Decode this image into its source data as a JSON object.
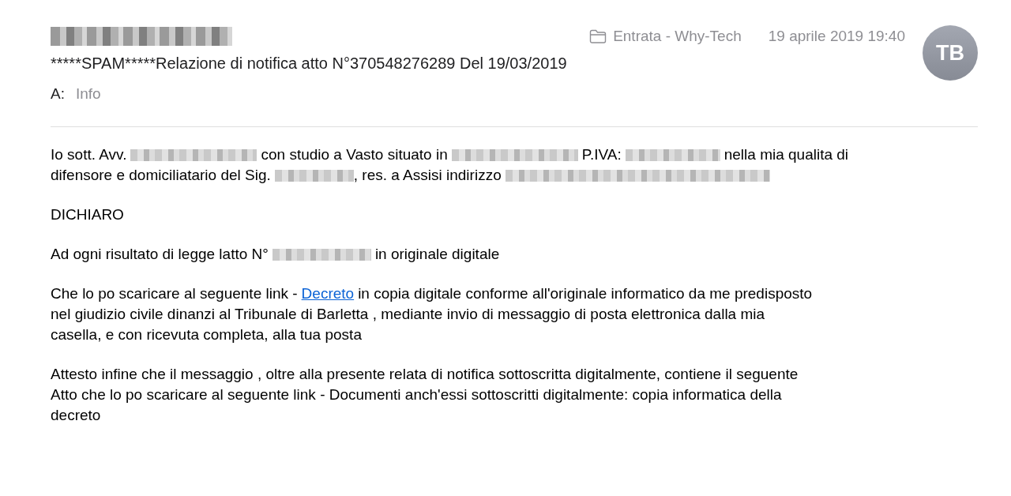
{
  "header": {
    "sender": {
      "kind": "redacted"
    },
    "folder": "Entrata - Why-Tech",
    "date": "19 aprile 2019 19:40",
    "avatar": "TB",
    "subject": "*****SPAM*****Relazione di notifica atto N°370548276289 Del 19/03/2019",
    "to_label": "A:",
    "to": "Info"
  },
  "body": [
    [
      [
        {
          "kind": "text",
          "text": "Io sott. Avv."
        },
        {
          "kind": "redacted"
        },
        {
          "kind": "text",
          "text": "con studio a Vasto situato in"
        },
        {
          "kind": "redacted"
        },
        {
          "kind": "text",
          "text": "P.IVA:"
        },
        {
          "kind": "redacted"
        },
        {
          "kind": "text",
          "text": "nella mia qualita di"
        }
      ],
      [
        {
          "kind": "text",
          "text": "difensore e domiciliatario del Sig."
        },
        {
          "kind": "redacted"
        },
        {
          "kind": "text",
          "text": ", res. a Assisi indirizzo"
        },
        {
          "kind": "redacted"
        }
      ]
    ],
    [
      [
        {
          "kind": "text",
          "text": "DICHIARO"
        }
      ]
    ],
    [
      [
        {
          "kind": "text",
          "text": "Ad ogni risultato di legge latto N°"
        },
        {
          "kind": "redacted"
        },
        {
          "kind": "text",
          "text": "in originale digitale"
        }
      ]
    ],
    [
      [
        {
          "kind": "text",
          "text": "Che lo po scaricare al seguente link -"
        },
        {
          "kind": "link",
          "text": "Decreto"
        },
        {
          "kind": "text",
          "text": "in copia digitale conforme all'originale informatico da me predisposto"
        }
      ],
      [
        {
          "kind": "text",
          "text": "nel giudizio civile dinanzi al Tribunale di Barletta , mediante invio di messaggio di posta elettronica dalla mia"
        }
      ],
      [
        {
          "kind": "text",
          "text": "casella, e con ricevuta completa, alla tua posta"
        }
      ]
    ],
    [
      [
        {
          "kind": "text",
          "text": "Attesto infine che il messaggio , oltre alla presente relata di notifica sottoscritta digitalmente, contiene il seguente"
        }
      ],
      [
        {
          "kind": "text",
          "text": "Atto che lo po scaricare al seguente link - Documenti anch'essi sottoscritti digitalmente: copia informatica della"
        }
      ],
      [
        {
          "kind": "text",
          "text": "decreto"
        }
      ]
    ]
  ]
}
